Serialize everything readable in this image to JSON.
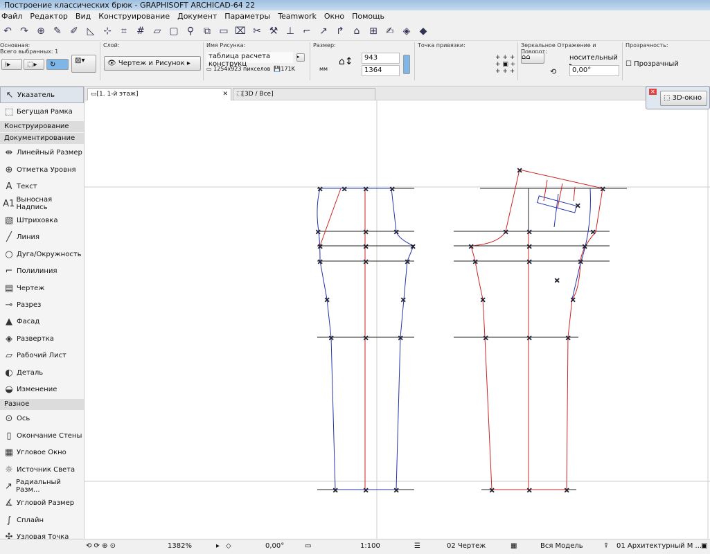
{
  "window": {
    "title": "Построение классических брюк - GRAPHISOFT ARCHICAD-64 22"
  },
  "menu": [
    "Файл",
    "Редактор",
    "Вид",
    "Конструирование",
    "Документ",
    "Параметры",
    "Teamwork",
    "Окно",
    "Помощь"
  ],
  "info": {
    "main_label": "Основная:",
    "selected": "Всего выбранных: 1",
    "layer_label": "Слой:",
    "layer_value": "Чертеж и Рисунок",
    "picture_label": "Имя Рисунка:",
    "picture_name": "таблица расчета конструкц",
    "pixels": "1254x923 пикселов",
    "filesize": "171K",
    "size_label": "Размер:",
    "unit": "мм",
    "width": "943",
    "height": "1364",
    "anchor_label": "Точка привязки:",
    "mirror_label": "Зеркальное Отражение и Поворот:",
    "relative": "носительный",
    "angle": "0,00°",
    "transparency_label": "Прозрачность:",
    "transparent": "Прозрачный",
    "transparent_checked": false
  },
  "tabs": [
    "[1. 1-й этаж]",
    "[3D / Все]"
  ],
  "window3d": "3D-окно",
  "sidebar": {
    "top": [
      {
        "label": "Указатель",
        "icon": "arrow-icon"
      },
      {
        "label": "Бегущая Рамка",
        "icon": "marquee-icon"
      }
    ],
    "headers": [
      "Конструирование",
      "Документирование",
      "Разное"
    ],
    "doc": [
      {
        "label": "Линейный Размер",
        "icon": "dimension-icon"
      },
      {
        "label": "Отметка Уровня",
        "icon": "level-icon"
      },
      {
        "label": "Текст",
        "icon": "text-icon"
      },
      {
        "label": "Выносная Надпись",
        "icon": "label-icon"
      },
      {
        "label": "Штриховка",
        "icon": "fill-icon"
      },
      {
        "label": "Линия",
        "icon": "line-icon"
      },
      {
        "label": "Дуга/Окружность",
        "icon": "arc-icon"
      },
      {
        "label": "Полилиния",
        "icon": "polyline-icon"
      },
      {
        "label": "Чертеж",
        "icon": "drawing-icon"
      },
      {
        "label": "Разрез",
        "icon": "section-icon"
      },
      {
        "label": "Фасад",
        "icon": "elevation-icon"
      },
      {
        "label": "Развертка",
        "icon": "interior-icon"
      },
      {
        "label": "Рабочий Лист",
        "icon": "worksheet-icon"
      },
      {
        "label": "Деталь",
        "icon": "detail-icon"
      },
      {
        "label": "Изменение",
        "icon": "change-icon"
      }
    ],
    "misc": [
      {
        "label": "Ось",
        "icon": "grid-icon"
      },
      {
        "label": "Окончание Стены",
        "icon": "wall-end-icon"
      },
      {
        "label": "Угловое Окно",
        "icon": "corner-window-icon"
      },
      {
        "label": "Источник Света",
        "icon": "lamp-icon"
      },
      {
        "label": "Радиальный Разм...",
        "icon": "radial-dim-icon"
      },
      {
        "label": "Угловой Размер",
        "icon": "angle-dim-icon"
      },
      {
        "label": "Сплайн",
        "icon": "spline-icon"
      },
      {
        "label": "Узловая Точка",
        "icon": "hotspot-icon"
      }
    ]
  },
  "status": {
    "zoom": "1382%",
    "angle": "0,00°",
    "scale": "1:100",
    "layer_combo": "02 Чертеж",
    "model": "Вся Модель",
    "pen_set": "01 Архитектурный М ..."
  }
}
